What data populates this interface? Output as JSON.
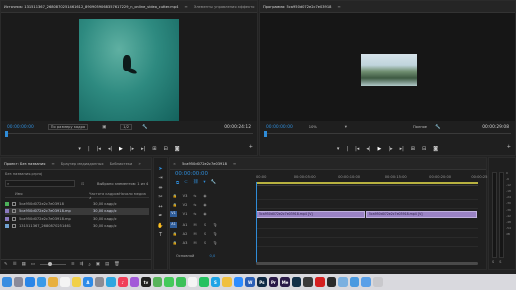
{
  "source": {
    "tabs": [
      {
        "label": "Источник: 131511367_2680870251461612_8909059068357617229_n_online_video_cutter.mp4",
        "active": true
      },
      {
        "label": "Элементы управления эффекто",
        "active": false
      }
    ],
    "timecode_left": "00:00:00:00",
    "fit_label": "По размеру кадра",
    "resolution": "1/2",
    "timecode_right": "00:00:24:12"
  },
  "program": {
    "tabs": [
      {
        "label": "Программа: 5ca950d072e2c7e03918",
        "active": true
      }
    ],
    "timecode_left": "00:00:00:00",
    "zoom": "10%",
    "quality": "Полное",
    "timecode_right": "00:00:29:08"
  },
  "project": {
    "tabs": [
      {
        "label": "Проект: Без названия",
        "active": true
      },
      {
        "label": "Браузер медиаданных",
        "active": false
      },
      {
        "label": "Библиотеки",
        "active": false
      }
    ],
    "path": "Без названия.prproj",
    "selection_info": "Выбрано элементов: 1 из 4",
    "columns": {
      "name": "Имя",
      "rate": "Частота кадров ∧",
      "start": "Начало медиа"
    },
    "items": [
      {
        "name": "5ca950d072e2c7e03918",
        "rate": "30,00 кадр/с",
        "color": "#4cb05a",
        "kind": "sequence",
        "highlight": false
      },
      {
        "name": "5ca950d072e2c7e03918.mp",
        "rate": "30,00 кадр/с",
        "color": "#8c7ac0",
        "kind": "video",
        "highlight": true
      },
      {
        "name": "5ca950d072e2c7e03918.mp",
        "rate": "30,00 кадр/с",
        "color": "#8c7ac0",
        "kind": "video",
        "highlight": false
      },
      {
        "name": "131511367_2680870251461",
        "rate": "30,00 кадр/с",
        "color": "#6fa0d0",
        "kind": "video",
        "highlight": false
      }
    ]
  },
  "timeline": {
    "tab_label": "5ca950d072e2c7e03918",
    "timecode": "00:00:00:00",
    "ticks": [
      "00:00",
      "00:00:05:00",
      "00:00:10:00",
      "00:00:15:00",
      "00:00:20:00",
      "00:00:25:00"
    ],
    "tracks": [
      {
        "id": "V3",
        "type": "video"
      },
      {
        "id": "V2",
        "type": "video"
      },
      {
        "id": "V1",
        "type": "video"
      },
      {
        "id": "A1",
        "type": "audio"
      },
      {
        "id": "A2",
        "type": "audio"
      },
      {
        "id": "A3",
        "type": "audio"
      }
    ],
    "clips": [
      {
        "label": "5ca950d072e2c7e03918.mp4 [V]",
        "track": "V1",
        "start_sec": 0,
        "end_sec": 14.5
      },
      {
        "label": "5ca950d072e2c7e03918.mp4 [V]",
        "track": "V1",
        "start_sec": 14.6,
        "end_sec": 29.3
      }
    ],
    "master_label": "Основной",
    "master_value": "0,0"
  },
  "meter": {
    "scale": [
      "0",
      "-6",
      "-12",
      "-18",
      "-24",
      "-30",
      "-36",
      "-42",
      "-48",
      "-54",
      "dB"
    ],
    "channels": [
      "S",
      "S"
    ]
  },
  "dock": [
    {
      "name": "finder",
      "color": "#3a8de0",
      "glyph": ""
    },
    {
      "name": "launchpad",
      "color": "#8a8a9a",
      "glyph": ""
    },
    {
      "name": "safari",
      "color": "#2a86e8",
      "glyph": ""
    },
    {
      "name": "mail",
      "color": "#3a9ae8",
      "glyph": ""
    },
    {
      "name": "photos",
      "color": "#e8b040",
      "glyph": ""
    },
    {
      "name": "calendar",
      "color": "#f4f4f4",
      "glyph": ""
    },
    {
      "name": "notes",
      "color": "#f1d04a",
      "glyph": ""
    },
    {
      "name": "app-store",
      "color": "#2e8be8",
      "glyph": "A"
    },
    {
      "name": "preferences",
      "color": "#8c8c94",
      "glyph": ""
    },
    {
      "name": "telegram",
      "color": "#2ea6df",
      "glyph": ""
    },
    {
      "name": "music",
      "color": "#f0405a",
      "glyph": "♪"
    },
    {
      "name": "podcasts",
      "color": "#a35ad8",
      "glyph": ""
    },
    {
      "name": "apple-tv",
      "color": "#202020",
      "glyph": "tv"
    },
    {
      "name": "maps",
      "color": "#57b35a",
      "glyph": ""
    },
    {
      "name": "messages",
      "color": "#45c95a",
      "glyph": ""
    },
    {
      "name": "facetime",
      "color": "#3cc058",
      "glyph": ""
    },
    {
      "name": "reminders",
      "color": "#f4f4f4",
      "glyph": ""
    },
    {
      "name": "whatsapp",
      "color": "#25c160",
      "glyph": ""
    },
    {
      "name": "skype",
      "color": "#1da4e6",
      "glyph": "S"
    },
    {
      "name": "chrome",
      "color": "#f0c040",
      "glyph": ""
    },
    {
      "name": "zoom",
      "color": "#2d8cff",
      "glyph": ""
    },
    {
      "name": "word",
      "color": "#2b5fb6",
      "glyph": "W"
    },
    {
      "name": "photoshop",
      "color": "#0f2a44",
      "glyph": "Ps"
    },
    {
      "name": "premiere",
      "color": "#2a1a48",
      "glyph": "Pr"
    },
    {
      "name": "media-encoder",
      "color": "#2a1a48",
      "glyph": "Me"
    },
    {
      "name": "lightroom",
      "color": "#123048",
      "glyph": ""
    },
    {
      "name": "activity-monitor",
      "color": "#3a3a3a",
      "glyph": ""
    },
    {
      "name": "acrobat",
      "color": "#d42020",
      "glyph": ""
    },
    {
      "name": "video-app",
      "color": "#2a2a2a",
      "glyph": ""
    },
    {
      "name": "preview",
      "color": "#7ab0e0",
      "glyph": ""
    },
    {
      "name": "finder-2",
      "color": "#4a9ae0",
      "glyph": ""
    },
    {
      "name": "downloads",
      "color": "#5aa0e8",
      "glyph": ""
    },
    {
      "name": "trash",
      "color": "#c8c8cc",
      "glyph": ""
    }
  ]
}
